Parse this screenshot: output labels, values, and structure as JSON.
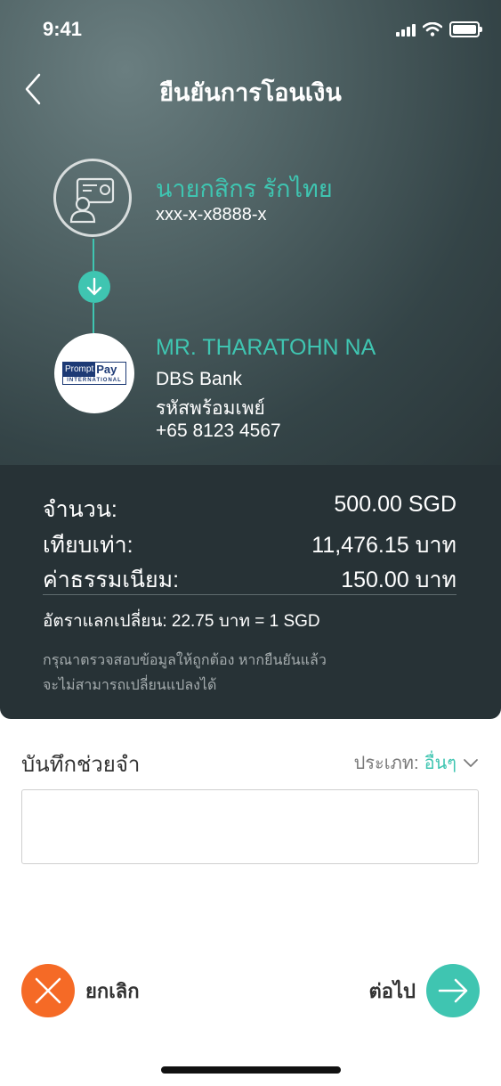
{
  "status_bar": {
    "time": "9:41"
  },
  "header": {
    "title": "ยืนยันการโอนเงิน"
  },
  "sender": {
    "name": "นายกสิกร รักไทย",
    "account": "xxx-x-x8888-x"
  },
  "recipient": {
    "name": "MR. THARATOHN NA",
    "bank": "DBS Bank",
    "id_type": "รหัสพร้อมเพย์",
    "phone": "+65 8123 4567",
    "logo": {
      "line1": "Prompt",
      "line2": "Pay",
      "line3": "INTERNATIONAL"
    }
  },
  "summary": {
    "amount_label": "จำนวน:",
    "amount_value": "500.00 SGD",
    "equivalent_label": "เทียบเท่า:",
    "equivalent_value": "11,476.15 บาท",
    "fee_label": "ค่าธรรมเนียม:",
    "fee_value": "150.00 บาท",
    "rate": "อัตราแลกเปลี่ยน: 22.75 บาท = 1 SGD",
    "note_line1": "กรุณาตรวจสอบข้อมูลให้ถูกต้อง หากยืนยันแล้ว",
    "note_line2": "จะไม่สามารถเปลี่ยนแปลงได้"
  },
  "memo": {
    "label": "บันทึกช่วยจำ",
    "type_prefix": "ประเภท:",
    "type_value": "อื่นๆ",
    "value": ""
  },
  "actions": {
    "cancel_label": "ยกเลิก",
    "next_label": "ต่อไป"
  },
  "colors": {
    "accent": "#3fc5b1",
    "cancel": "#f56a26",
    "summary_bg": "#273236"
  }
}
